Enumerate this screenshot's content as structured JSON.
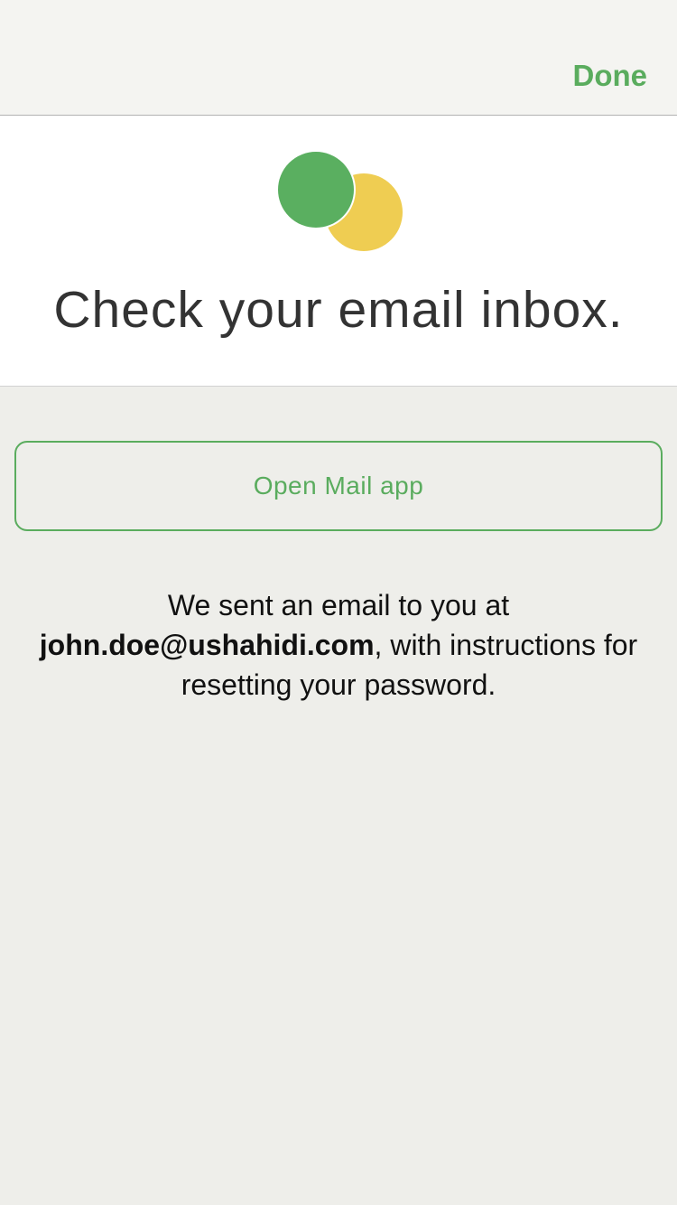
{
  "nav": {
    "done_label": "Done"
  },
  "header": {
    "title": "Check your email inbox.",
    "logo_icon": "ushahidi-logo-icon"
  },
  "actions": {
    "open_mail_label": "Open Mail app"
  },
  "message": {
    "prefix": "We sent an email to you at",
    "email": "john.doe@ushahidi.com",
    "suffix": ", with instructions for resetting your password."
  },
  "colors": {
    "accent_green": "#5aac5e",
    "logo_green": "#5aaf60",
    "logo_yellow": "#efcd52"
  }
}
